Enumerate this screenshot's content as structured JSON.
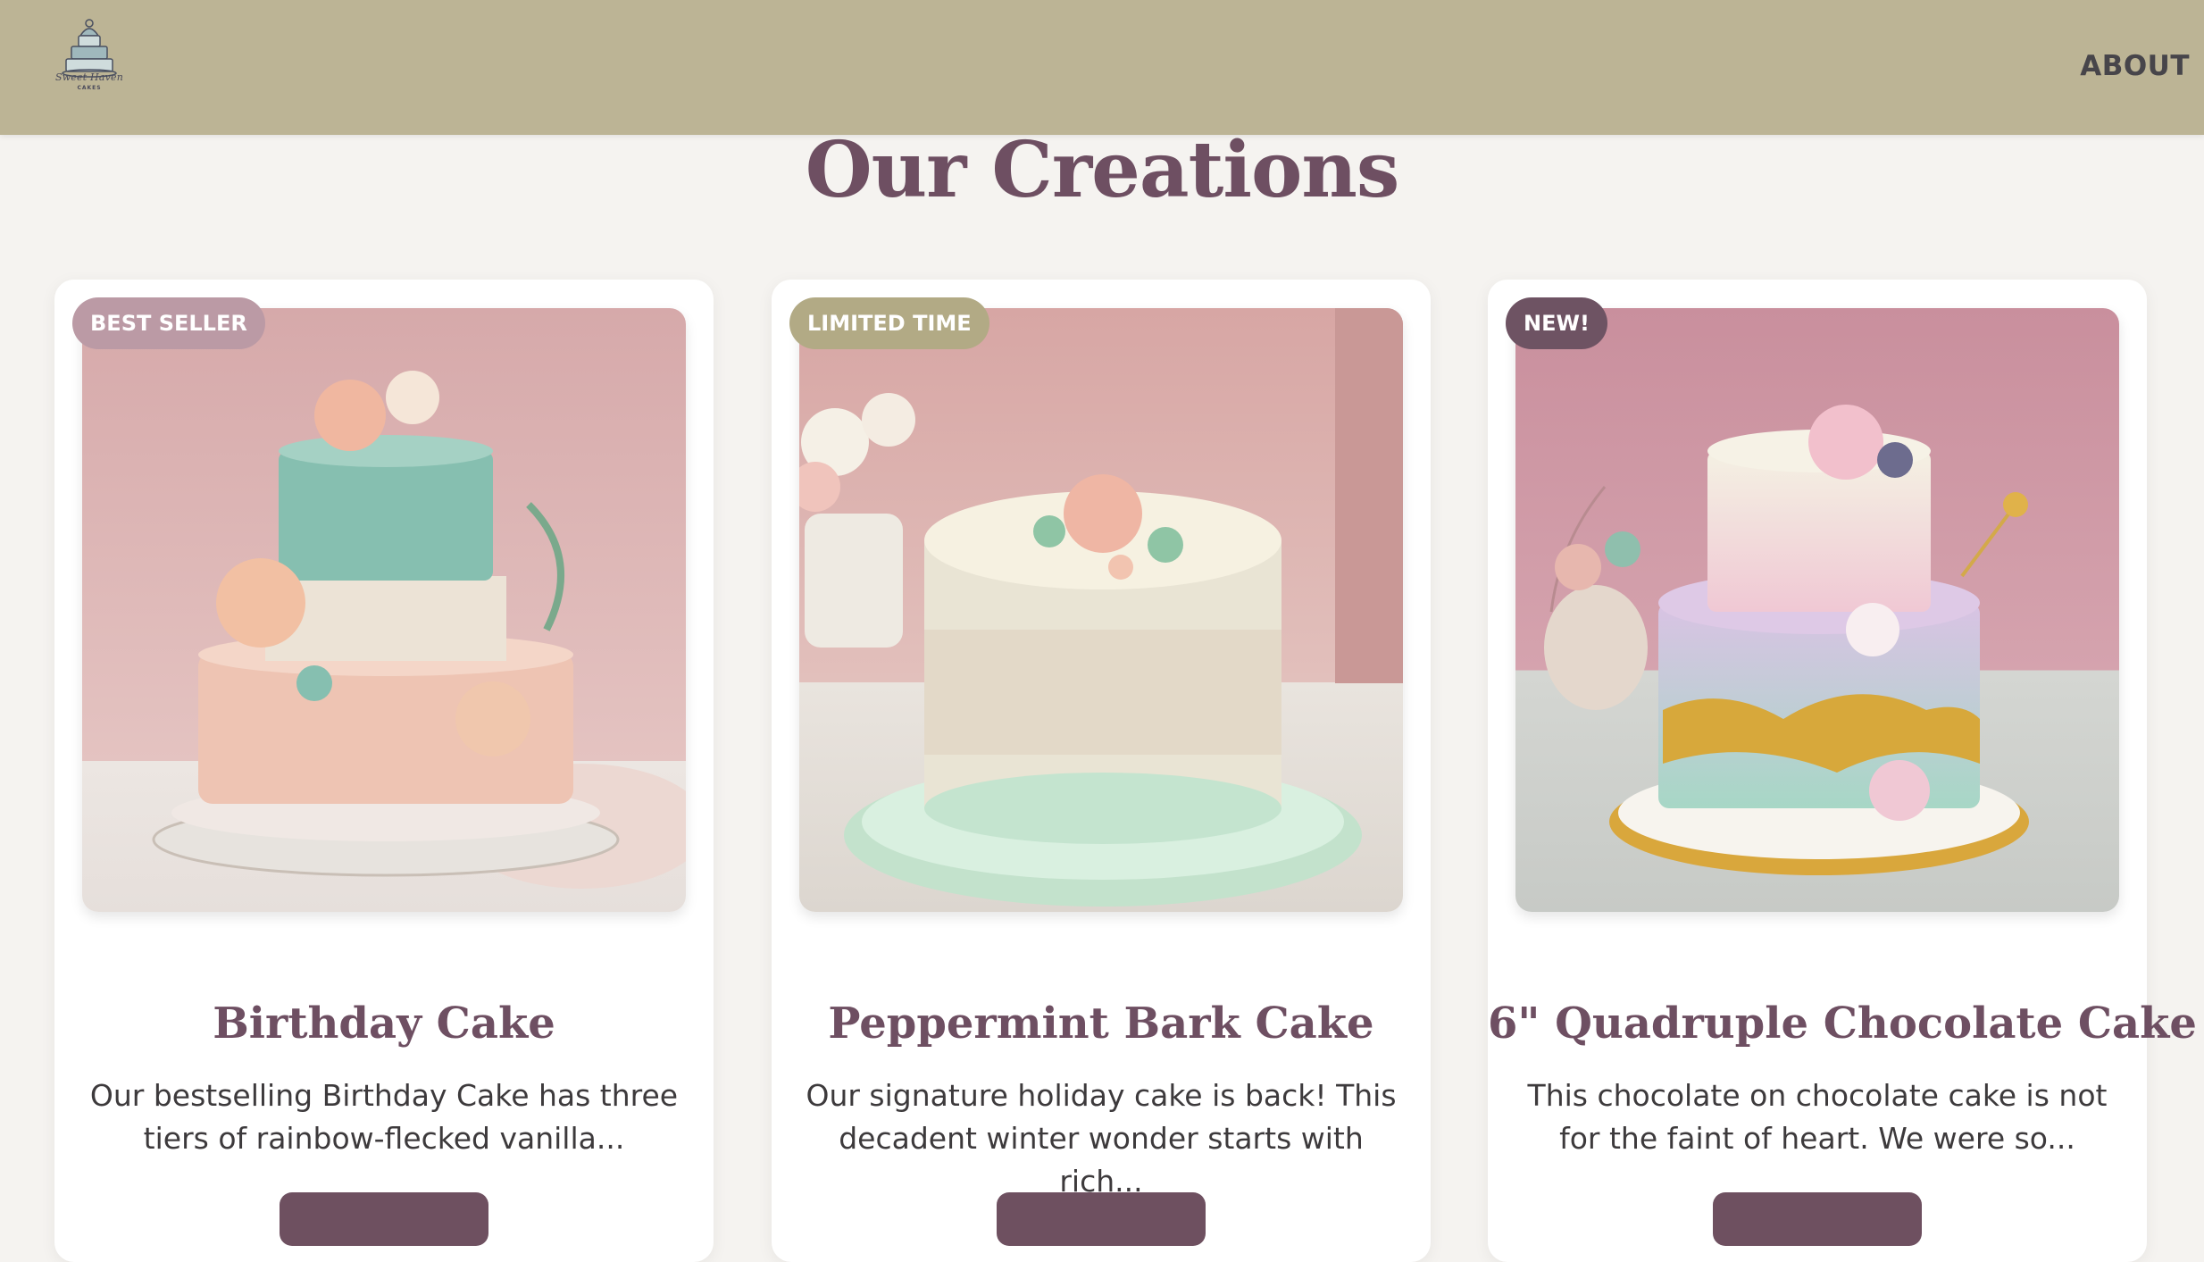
{
  "header": {
    "logo_text": "Sweet Haven",
    "logo_subtext": "CAKES",
    "nav": {
      "about_label": "ABOUT"
    }
  },
  "main": {
    "title": "Our Creations",
    "cards": [
      {
        "badge": "BEST SELLER",
        "badge_color": "#bb9aa5",
        "title": "Birthday Cake",
        "description": "Our bestselling Birthday Cake has three tiers of rainbow-flecked vanilla...",
        "image": "three-tier pastel floral cake"
      },
      {
        "badge": "LIMITED TIME",
        "badge_color": "#b2aa85",
        "title": "Peppermint Bark Cake",
        "description": "Our signature holiday cake is back! This decadent winter wonder starts with rich...",
        "image": "single-tier mint and cream lace cake"
      },
      {
        "badge": "NEW!",
        "badge_color": "#6e5363",
        "title": "6\" Quadruple Chocolate Cake",
        "description": "This chocolate on chocolate cake is not for the faint of heart. We were so...",
        "image": "two-tier ombre cake with gold leaf"
      }
    ]
  },
  "colors": {
    "header_bg": "#bcb495",
    "page_bg": "#f5f3f0",
    "title_color": "#6e4f62"
  }
}
